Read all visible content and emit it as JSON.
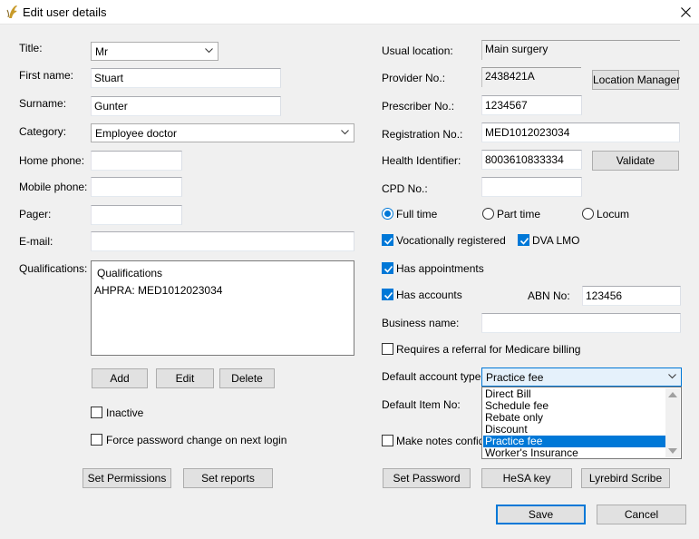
{
  "window": {
    "title": "Edit user details"
  },
  "left": {
    "title_label": "Title:",
    "title_value": "Mr",
    "first_name_label": "First name:",
    "first_name_value": "Stuart",
    "surname_label": "Surname:",
    "surname_value": "Gunter",
    "category_label": "Category:",
    "category_value": "Employee doctor",
    "home_phone_label": "Home phone:",
    "home_phone_value": "",
    "mobile_phone_label": "Mobile phone:",
    "mobile_phone_value": "",
    "pager_label": "Pager:",
    "pager_value": "",
    "email_label": "E-mail:",
    "email_value": "",
    "qualifications_label": "Qualifications:",
    "qualifications_header": "Qualifications",
    "qualifications_items": [
      "AHPRA: MED1012023034"
    ],
    "add_label": "Add",
    "edit_label": "Edit",
    "delete_label": "Delete",
    "inactive_label": "Inactive",
    "inactive_checked": false,
    "force_pw_label": "Force password change on next login",
    "force_pw_checked": false,
    "set_permissions_label": "Set Permissions",
    "set_reports_label": "Set reports"
  },
  "right": {
    "usual_location_label": "Usual location:",
    "usual_location_value": "Main surgery",
    "provider_no_label": "Provider No.:",
    "provider_no_value": "2438421A",
    "location_manager_label": "Location Manager",
    "prescriber_no_label": "Prescriber No.:",
    "prescriber_no_value": "1234567",
    "registration_no_label": "Registration No.:",
    "registration_no_value": "MED1012023034",
    "health_identifier_label": "Health Identifier:",
    "health_identifier_value": "8003610833334",
    "validate_label": "Validate",
    "cpd_no_label": "CPD No.:",
    "cpd_no_value": "",
    "employment_options": [
      "Full time",
      "Part time",
      "Locum"
    ],
    "employment_selected": "Full time",
    "vocationally_registered_label": "Vocationally registered",
    "dva_lmo_label": "DVA LMO",
    "has_appointments_label": "Has appointments",
    "has_accounts_label": "Has accounts",
    "abn_label": "ABN No:",
    "abn_value": "123456",
    "business_name_label": "Business name:",
    "business_name_value": "",
    "requires_referral_label": "Requires a referral for Medicare billing",
    "default_account_type_label": "Default account type:",
    "default_account_type_value": "Practice fee",
    "account_type_options": [
      "Direct Bill",
      "Schedule fee",
      "Rebate only",
      "Discount",
      "Practice fee",
      "Worker's Insurance"
    ],
    "default_item_no_label": "Default Item No:",
    "make_notes_label": "Make notes confide",
    "set_password_label": "Set Password",
    "hesa_key_label": "HeSA key",
    "lyrebird_label": "Lyrebird Scribe"
  },
  "footer": {
    "save_label": "Save",
    "cancel_label": "Cancel"
  },
  "colors": {
    "accent": "#0078d7",
    "window_bg": "#f0f0f0"
  }
}
